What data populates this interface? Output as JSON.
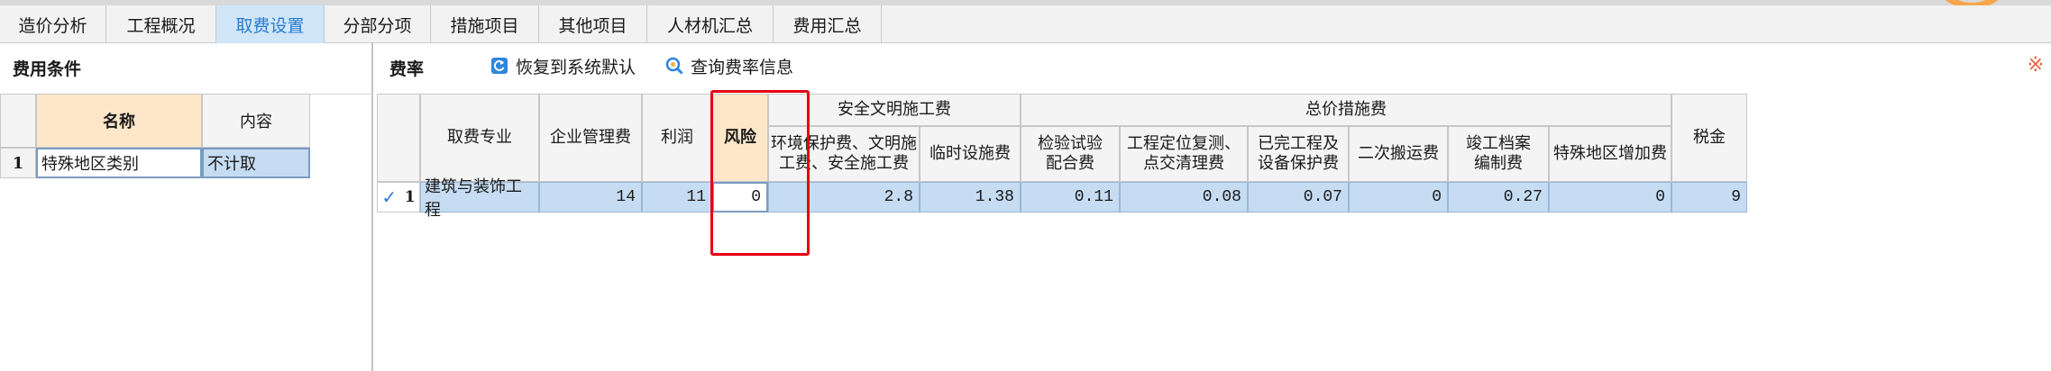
{
  "tabs": [
    {
      "label": "造价分析",
      "active": false
    },
    {
      "label": "工程概况",
      "active": false
    },
    {
      "label": "取费设置",
      "active": true
    },
    {
      "label": "分部分项",
      "active": false
    },
    {
      "label": "措施项目",
      "active": false
    },
    {
      "label": "其他项目",
      "active": false
    },
    {
      "label": "人材机汇总",
      "active": false
    },
    {
      "label": "费用汇总",
      "active": false
    }
  ],
  "left_panel": {
    "title": "费用条件",
    "columns": {
      "name": "名称",
      "content": "内容"
    },
    "rows": [
      {
        "index": "1",
        "name": "特殊地区类别",
        "content": "不计取"
      }
    ]
  },
  "right_panel": {
    "title": "费率",
    "restore_label": "恢复到系统默认",
    "query_label": "查询费率信息",
    "far_mark": "※",
    "headers": {
      "fee_major": "取费专业",
      "mgmt": "企业管理费",
      "profit": "利润",
      "risk": "风险",
      "safety_group": "安全文明施工费",
      "env": "环境保护费、文明施工费、安全施工费",
      "temp": "临时设施费",
      "total_group": "总价措施费",
      "inspect": "检验试验配合费",
      "locate": "工程定位复测、点交清理费",
      "protect": "已完工程及设备保护费",
      "transport": "二次搬运费",
      "archive": "竣工档案编制费",
      "special": "特殊地区增加费",
      "tax": "税金"
    },
    "rows": [
      {
        "check": "✓",
        "index": "1",
        "fee_major": "建筑与装饰工程",
        "mgmt": "14",
        "profit": "11",
        "risk": "0",
        "env": "2.8",
        "temp": "1.38",
        "inspect": "0.11",
        "locate": "0.08",
        "protect": "0.07",
        "transport": "0",
        "archive": "0.27",
        "special": "0",
        "tax": "9"
      }
    ]
  },
  "colors": {
    "active_tab_bg": "#cfe6f8",
    "active_tab_text": "#2a7bd1",
    "selected_row": "#c6dcf2",
    "highlight_header": "#fde7c8",
    "annotation_red": "#e60012",
    "check_blue": "#2a7bd1"
  }
}
